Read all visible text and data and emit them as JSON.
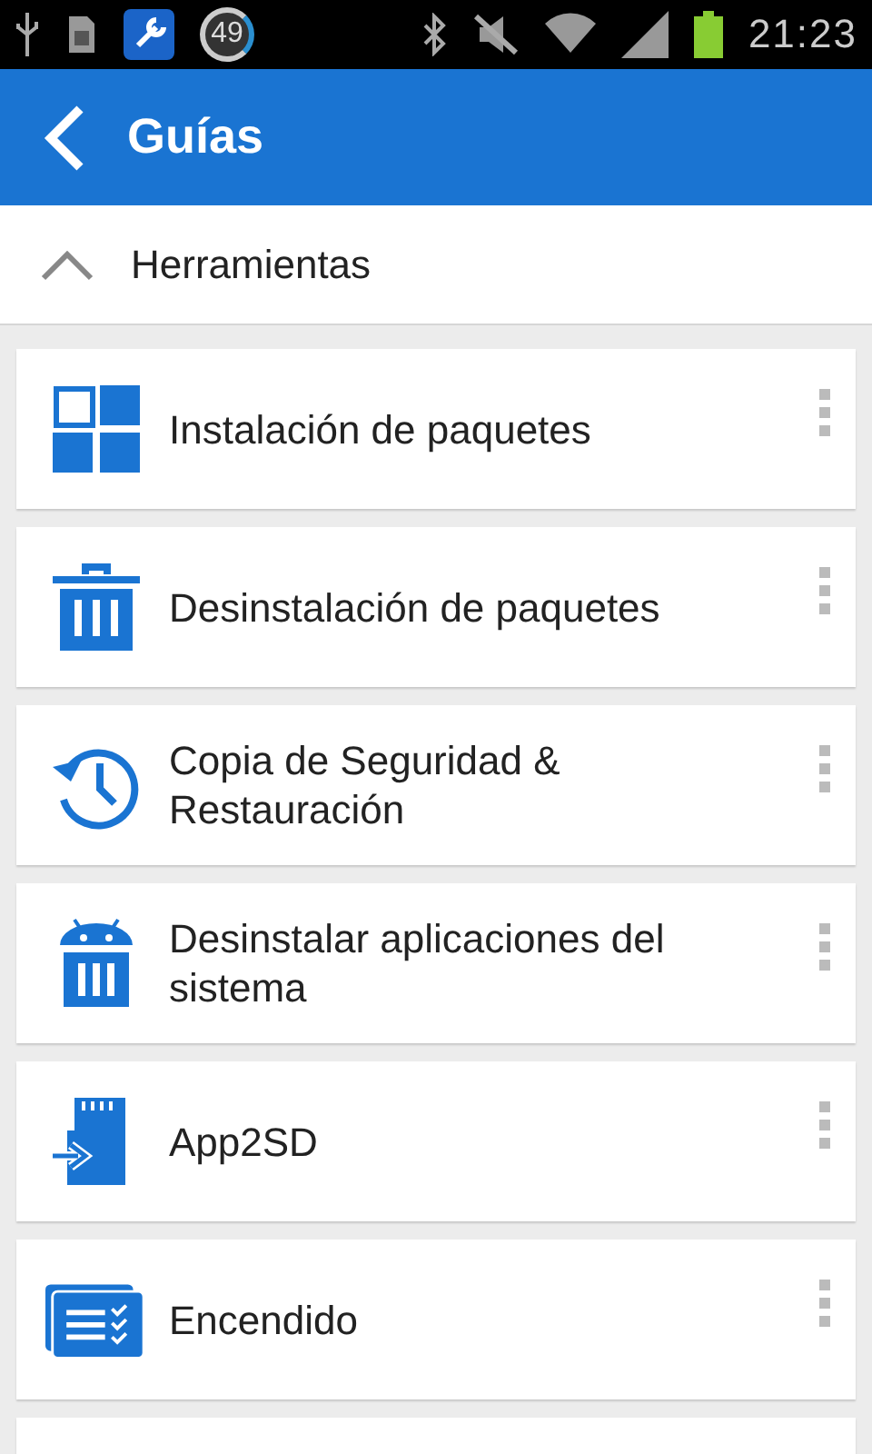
{
  "status_bar": {
    "notification_count": "49",
    "time": "21:23"
  },
  "app_bar": {
    "title": "Guías"
  },
  "section": {
    "title": "Herramientas",
    "expanded": true
  },
  "items": [
    {
      "kind": "grid",
      "label": "Instalación de paquetes"
    },
    {
      "kind": "trash",
      "label": "Desinstalación de paquetes"
    },
    {
      "kind": "history",
      "label": "Copia de Seguridad & Restauración"
    },
    {
      "kind": "android-trash",
      "label": "Desinstalar aplicaciones del sistema"
    },
    {
      "kind": "sd-card",
      "label": "App2SD"
    },
    {
      "kind": "checklist",
      "label": "Encendido"
    }
  ]
}
